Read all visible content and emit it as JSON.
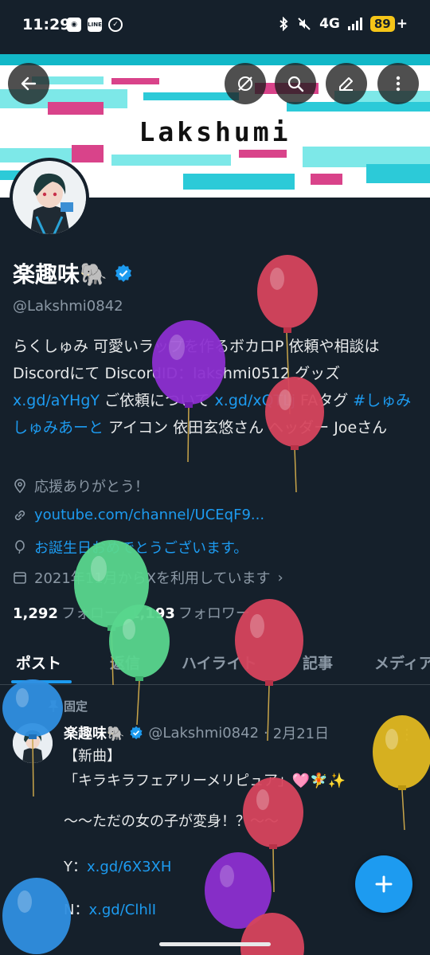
{
  "status_bar": {
    "time": "11:29",
    "network": "4G",
    "battery": "89",
    "battery_suffix": "+",
    "left_icons": [
      "discord-icon",
      "line-icon",
      "check-circle-icon"
    ],
    "right_icons": [
      "bluetooth-icon",
      "mute-icon",
      "signal-icon",
      "battery-icon"
    ],
    "line_label": "LINE"
  },
  "header": {
    "banner_title": "Lakshumi",
    "buttons": [
      "back-icon",
      "eye-off-icon",
      "search-icon",
      "edit-icon",
      "more-vertical-icon"
    ]
  },
  "profile": {
    "name": "楽趣味🐘",
    "handle": "@Lakshmi0842",
    "bio_parts": [
      {
        "text": "らくしゅみ 可愛いラップを作るボカロP 依頼や相談はDiscordにて DiscordID：lakshmi0512 グッズ ",
        "link": false
      },
      {
        "text": "x.gd/aYHgY",
        "link": true
      },
      {
        "text": " ご依頼について ",
        "link": false
      },
      {
        "text": "x.gd/xQTLj",
        "link": true
      },
      {
        "text": " FAタグ ",
        "link": false
      },
      {
        "text": "#しゅみしゅみあーと",
        "link": true
      },
      {
        "text": " アイコン 依田玄悠さん ヘッダー Joeさん",
        "link": false
      }
    ],
    "location": "応援ありがとう！",
    "website": "youtube.com/channel/UCEqF9...",
    "birthday": "お誕生日おめでとうございます。",
    "joined": "2021年11月からXを利用しています",
    "following_count": "1,292",
    "following_label": "フォロー",
    "followers_count": "1,193",
    "followers_label": "フォロワー"
  },
  "tabs": [
    {
      "label": "ポスト",
      "active": true
    },
    {
      "label": "返信",
      "active": false
    },
    {
      "label": "ハイライト",
      "active": false
    },
    {
      "label": "記事",
      "active": false
    },
    {
      "label": "メディア",
      "active": false
    }
  ],
  "pinned_post": {
    "pinned_label": "固定",
    "author_name": "楽趣味🐘",
    "author_handle": "@Lakshmi0842",
    "separator": "·",
    "date": "2月21日",
    "line1": "【新曲】",
    "line2": "「キラキラフェアリーメリピュア」🩷🧚✨",
    "line3": "〜〜ただの女の子が変身！？〜〜",
    "y_label": "Y：",
    "y_link": "x.gd/6X3XH",
    "n_label": "N：",
    "n_link": "x.gd/ClhlI"
  },
  "fab": {
    "icon": "plus-icon"
  },
  "balloon_colors": {
    "red": "#d6455d",
    "purple": "#8c2fd0",
    "green": "#58d68d",
    "blue": "#2f8fe0",
    "yellow": "#e0b820"
  },
  "accent": "#1d9bf0",
  "background": "#15202b"
}
